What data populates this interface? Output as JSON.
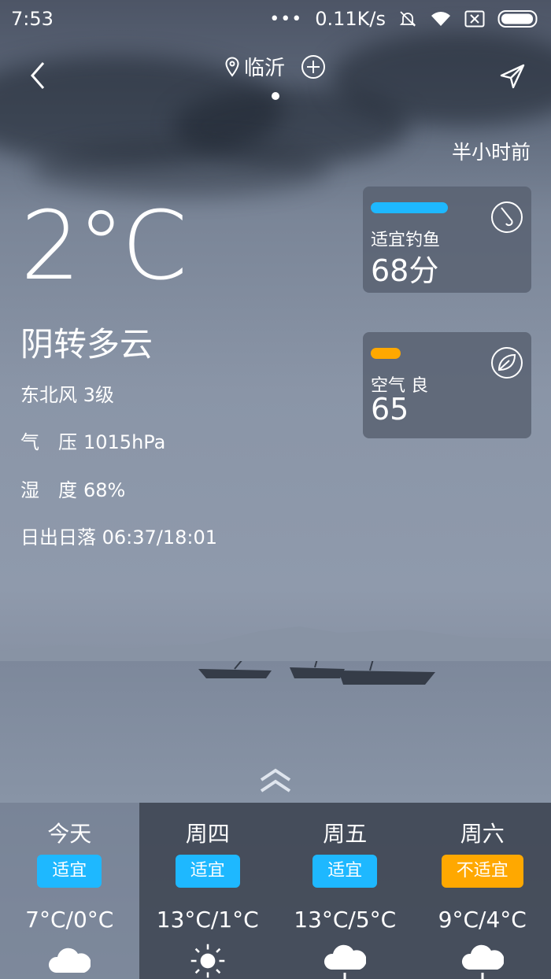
{
  "status_bar": {
    "time": "7:53",
    "net_speed": "0.11K/s"
  },
  "header": {
    "city": "临沂"
  },
  "updated_text": "半小时前",
  "current": {
    "temperature": "2°C",
    "condition": "阴转多云",
    "wind": "东北风 3级",
    "pressure_label": "气　压",
    "pressure_value": "1015hPa",
    "humidity_label": "湿　度",
    "humidity_value": "68%",
    "sun_label": "日出日落",
    "sun_value": "06:37/18:01"
  },
  "cards": [
    {
      "label": "适宜钓鱼",
      "value": "68分",
      "color": "#1eb8ff",
      "icon": "fishing-hook-icon"
    },
    {
      "label": "空气 良",
      "value": "65",
      "color": "#ffa800",
      "icon": "leaf-icon"
    }
  ],
  "forecast": [
    {
      "day": "今天",
      "badge": "适宜",
      "badge_color": "#1eb8ff",
      "range": "7°C/0°C",
      "icon": "cloudy-icon"
    },
    {
      "day": "周四",
      "badge": "适宜",
      "badge_color": "#1eb8ff",
      "range": "13°C/1°C",
      "icon": "sunny-icon"
    },
    {
      "day": "周五",
      "badge": "适宜",
      "badge_color": "#1eb8ff",
      "range": "13°C/5°C",
      "icon": "cloud-rain-icon"
    },
    {
      "day": "周六",
      "badge": "不适宜",
      "badge_color": "#ffa800",
      "range": "9°C/4°C",
      "icon": "cloud-rain-icon"
    }
  ]
}
